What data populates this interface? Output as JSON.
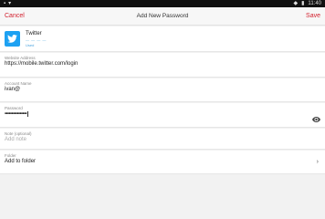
{
  "status_bar": {
    "time": "11:40"
  },
  "toolbar": {
    "cancel_label": "Cancel",
    "title": "Add New Password",
    "save_label": "Save"
  },
  "item": {
    "name": "Twitter",
    "tag": "Used",
    "icon": "twitter-bird-icon",
    "icon_color": "#1da1f2"
  },
  "fields": {
    "website": {
      "label": "Website Address",
      "value": "https://mobile.twitter.com/login"
    },
    "account": {
      "label": "Account Name",
      "value": "ivan@"
    },
    "password": {
      "label": "Password",
      "value": "••••••••••••••••"
    },
    "note": {
      "label": "Note (optional)",
      "placeholder": "Add note"
    },
    "folder": {
      "label": "Folder",
      "value": "Add to folder"
    }
  },
  "accent_color": "#d21f2d"
}
